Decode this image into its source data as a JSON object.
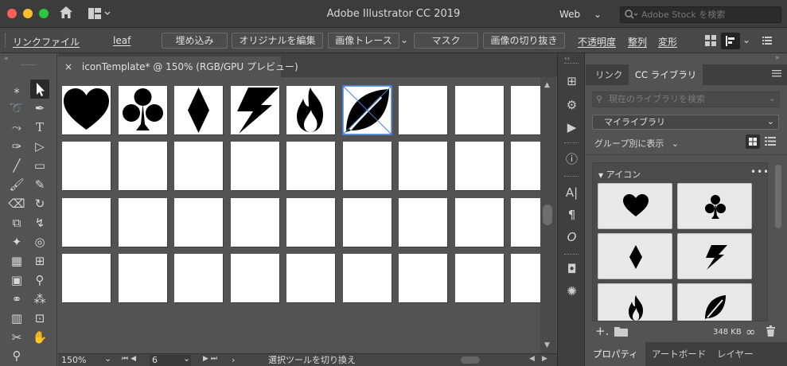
{
  "window": {
    "title": "Adobe Illustrator CC 2019"
  },
  "titlebar": {
    "workspace": "Web",
    "stock_placeholder": "Adobe Stock を検索"
  },
  "control": {
    "linked_file": "リンクファイル",
    "file_name": "leaf",
    "embed": "埋め込み",
    "edit_original": "オリジナルを編集",
    "image_trace": "画像トレース",
    "mask": "マスク",
    "crop_image": "画像の切り抜き",
    "opacity": "不透明度",
    "align": "整列",
    "transform": "変形"
  },
  "document": {
    "tab_title": "iconTemplate* @ 150% (RGB/GPU プレビュー)"
  },
  "status": {
    "zoom": "150%",
    "artboard": "6",
    "tool_hint": "選択ツールを切り換え"
  },
  "panel": {
    "tabs": [
      "リンク",
      "CC ライブラリ"
    ],
    "search_placeholder": "現在のライブラリを検索",
    "library": "マイライブラリ",
    "group_by": "グループ別に表示",
    "group_name": "アイコン",
    "size": "348 KB",
    "bottom_tabs": [
      "プロパティ",
      "アートボード",
      "レイヤー"
    ]
  },
  "colors": {
    "selection": "#4a7fd6",
    "accent_tab": "#535353"
  },
  "icons": [
    "heart-icon",
    "club-icon",
    "diamond-icon",
    "lightning-icon",
    "flame-icon",
    "leaf-icon"
  ]
}
